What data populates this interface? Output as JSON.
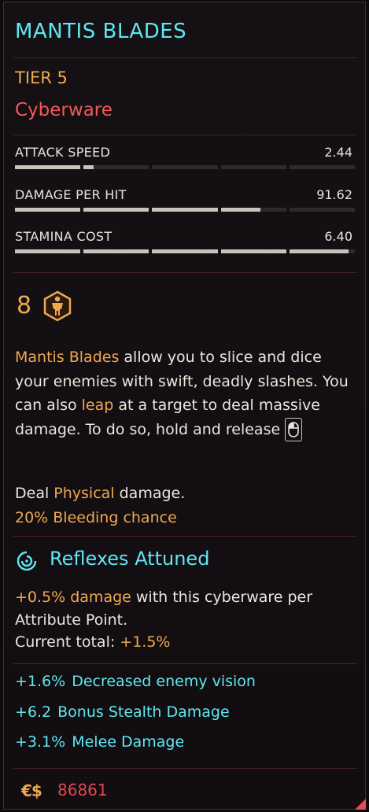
{
  "item": {
    "name": "MANTIS BLADES",
    "tier": "TIER 5",
    "type": "Cyberware"
  },
  "stats": [
    {
      "name": "ATTACK SPEED",
      "value": "2.44",
      "fill": 0.23
    },
    {
      "name": "DAMAGE PER HIT",
      "value": "91.62",
      "fill": 0.72
    },
    {
      "name": "STAMINA COST",
      "value": "6.40",
      "fill": 0.98
    }
  ],
  "requirement": {
    "level": "8",
    "icon": "body-attribute-icon"
  },
  "description": {
    "p1": "Mantis Blades",
    "p2": " allow you to slice and dice your enemies with swift, deadly slashes. You can also ",
    "p3": "leap",
    "p4": " at a target to deal massive damage. To do so, hold and release",
    "mouse_icon": "mouse-button-icon"
  },
  "damage": {
    "deal": "Deal ",
    "type": "Physical",
    "suffix": " damage.",
    "bleeding": "20% Bleeding chance"
  },
  "attunement": {
    "title": "Reflexes Attuned",
    "bonus_value": "+0.5% damage",
    "bonus_text": " with this cyberware per Attribute Point.",
    "current_label": "Current total: ",
    "current_value": "+1.5%"
  },
  "bonuses": [
    {
      "value": "+1.6%",
      "label": "Decreased enemy vision"
    },
    {
      "value": "+6.2",
      "label": "Bonus Stealth Damage"
    },
    {
      "value": "+3.1%",
      "label": "Melee Damage"
    }
  ],
  "price": {
    "currency": "€$",
    "amount": "86861"
  },
  "colors": {
    "cyan": "#5ee7f2",
    "orange": "#f0a850",
    "red": "#f1585b",
    "border": "#5a2329"
  }
}
